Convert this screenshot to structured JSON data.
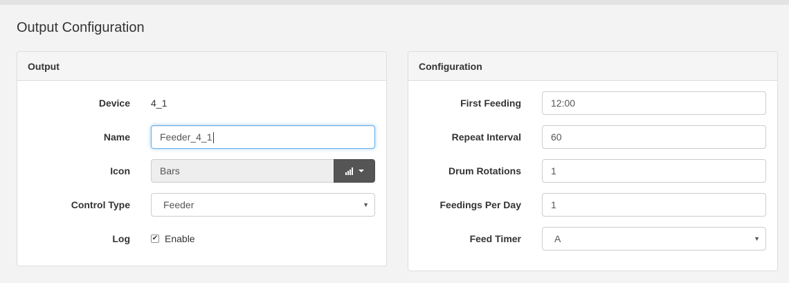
{
  "page": {
    "title": "Output Configuration"
  },
  "output_panel": {
    "heading": "Output",
    "device": {
      "label": "Device",
      "value": "4_1"
    },
    "name": {
      "label": "Name",
      "value": "Feeder_4_1"
    },
    "icon": {
      "label": "Icon",
      "value": "Bars",
      "button_icon": "bars-icon"
    },
    "control_type": {
      "label": "Control Type",
      "value": "Feeder"
    },
    "log": {
      "label": "Log",
      "checkbox_label": "Enable",
      "checked": true
    }
  },
  "configuration_panel": {
    "heading": "Configuration",
    "first_feeding": {
      "label": "First Feeding",
      "value": "12:00"
    },
    "repeat_interval": {
      "label": "Repeat Interval",
      "value": "60"
    },
    "drum_rotations": {
      "label": "Drum Rotations",
      "value": "1"
    },
    "feedings_per_day": {
      "label": "Feedings Per Day",
      "value": "1"
    },
    "feed_timer": {
      "label": "Feed Timer",
      "value": "A"
    }
  },
  "colors": {
    "background": "#f3f3f3",
    "panel_heading": "#f5f5f5",
    "focus_border": "#66afe9",
    "icon_button": "#555555"
  }
}
